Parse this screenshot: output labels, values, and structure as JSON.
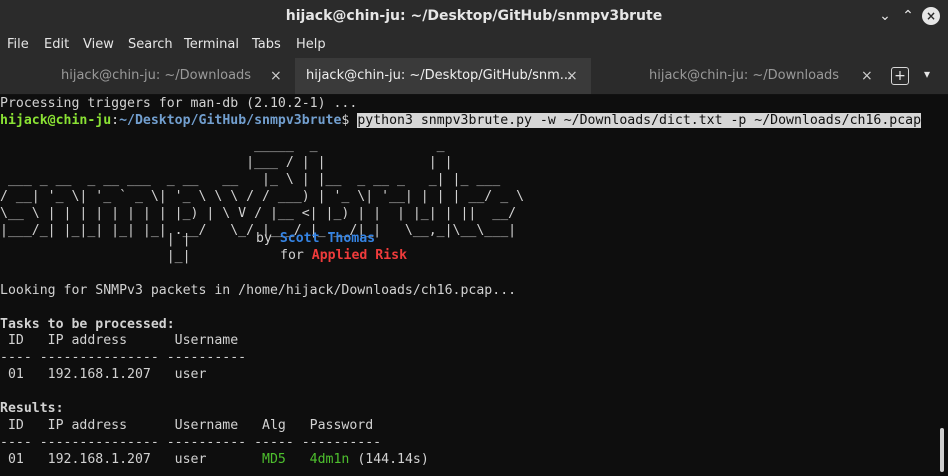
{
  "window": {
    "title": "hijack@chin-ju: ~/Desktop/GitHub/snmpv3brute"
  },
  "menu": [
    "File",
    "Edit",
    "View",
    "Search",
    "Terminal",
    "Tabs",
    "Help"
  ],
  "tabs": [
    {
      "label": "hijack@chin-ju: ~/Downloads",
      "active": false
    },
    {
      "label": "hijack@chin-ju: ~/Desktop/GitHub/snm...",
      "active": true
    },
    {
      "label": "hijack@chin-ju: ~/Downloads",
      "active": false
    }
  ],
  "icons": {
    "tab_close": "×",
    "new_tab": "+",
    "tab_menu": "▾",
    "minimize": "⌄",
    "maximize": "⌃",
    "close": "×"
  },
  "terminal": {
    "line1": "Processing triggers for man-db (2.10.2-1) ...",
    "prompt_user": "hijack@chin-ju",
    "prompt_colon": ":",
    "prompt_path": "~/Desktop/GitHub/snmpv3brute",
    "prompt_dollar": "$ ",
    "command": "python3 snmpv3brute.py -w ~/Downloads/dict.txt -p ~/Downloads/ch16.pcap",
    "ascii_art": [
      "                                _____  _               _",
      "                               |___ / | |             | |",
      " ___ _ __  _ __ ___  _ __   __   |_ \\ | |__  _ __ _   _| |_ ___",
      "/ __| '_ \\| '_ ` _ \\| '_ \\ \\ \\ / / ___) | '_ \\| '__| | | | __/ _ \\",
      "\\__ \\ | | | | | | | | |_) | \\ V / |__ <| |_) | |  | |_| | ||  __/",
      "|___/_| |_|_| |_| |_| .__/   \\_/ |___/ |_.__/|_|   \\__,_|\\__\\___|",
      "                     | |",
      "                     |_|"
    ],
    "credit_by": "by ",
    "credit_name": "Scott Thomas",
    "credit_for": "for ",
    "credit_company": "Applied Risk",
    "looking": "Looking for SNMPv3 packets in /home/hijack/Downloads/ch16.pcap...",
    "tasks_header": "Tasks to be processed:",
    "tasks_cols": " ID   IP address      Username",
    "tasks_sep": "---- --------------- ----------",
    "tasks_row": " 01   192.168.1.207   user",
    "results_header": "Results:",
    "results_cols": " ID   IP address      Username   Alg   Password",
    "results_sep": "---- --------------- ---------- ----- ----------",
    "results_row": {
      "id": " 01   192.168.1.207   user       ",
      "alg": "MD5",
      "gap": "   ",
      "password": "4dm1n",
      "time": " (144.14s)"
    }
  }
}
